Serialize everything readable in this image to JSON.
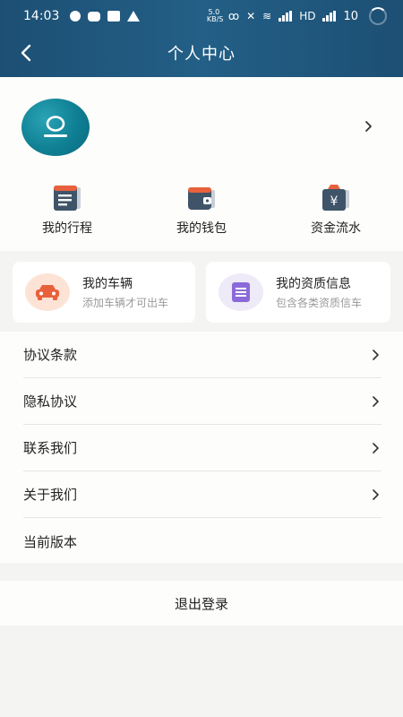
{
  "status_bar": {
    "time": "14:03",
    "network_speed": "5.0 KB/S",
    "network_type": "HD",
    "battery": "10"
  },
  "header": {
    "title": "个人中心"
  },
  "quick_actions": [
    {
      "label": "我的行程",
      "icon": "itinerary-icon"
    },
    {
      "label": "我的钱包",
      "icon": "wallet-icon"
    },
    {
      "label": "资金流水",
      "icon": "yuan-bag-icon"
    }
  ],
  "feature_cards": [
    {
      "title": "我的车辆",
      "subtitle": "添加车辆才可出车",
      "icon": "car-icon"
    },
    {
      "title": "我的资质信息",
      "subtitle": "包含各类资质信车",
      "icon": "document-icon"
    }
  ],
  "menu": [
    {
      "label": "协议条款",
      "has_chevron": true
    },
    {
      "label": "隐私协议",
      "has_chevron": true
    },
    {
      "label": "联系我们",
      "has_chevron": true
    },
    {
      "label": "关于我们",
      "has_chevron": true
    },
    {
      "label": "当前版本",
      "has_chevron": false
    }
  ],
  "logout": {
    "label": "退出登录"
  },
  "colors": {
    "header": "#1d4f74",
    "avatar": "#0f7f93",
    "car_bg": "#fde3d6",
    "car_icon": "#e8613c",
    "doc_bg": "#eeeaf7",
    "doc_icon": "#8a6ad8"
  }
}
